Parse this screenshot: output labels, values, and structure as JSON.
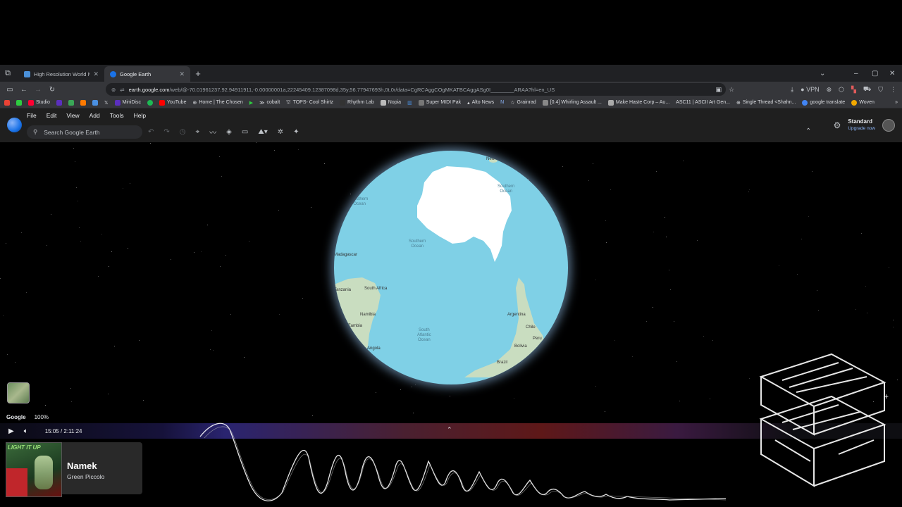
{
  "tabs": [
    {
      "title": "High Resolution World Map - G",
      "active": false,
      "favicon_color": "#4a90d9"
    },
    {
      "title": "Google Earth",
      "active": true,
      "favicon_color": "#1a73e8"
    }
  ],
  "address": {
    "host": "earth.google.com",
    "path": "/web/@-70.01961237,92.94911911,-0.00000001a,22245409.12387098d,35y,56.77947693h,0t,0r/data=CgRCAggCOgMKATBCAggASg0I________ARAA?hl=en_US"
  },
  "toolbar_right": {
    "vpn_label": "VPN"
  },
  "bookmarks": [
    {
      "label": "Studio",
      "color": "#ff0033"
    },
    {
      "label": "MiniDisc",
      "color": "#5b2fbf"
    },
    {
      "label": "YouTube",
      "color": "#ff0000"
    },
    {
      "label": "Home | The Chosen",
      "color": "#cccccc"
    },
    {
      "label": "cobalt",
      "color": "#ffffff"
    },
    {
      "label": "TOPS- Cool Shirtz",
      "color": "#999999"
    },
    {
      "label": "Rhythm Lab",
      "color": "#333333"
    },
    {
      "label": "Nopia",
      "color": "#bbbbbb"
    },
    {
      "label": "Super MIDI Pak",
      "color": "#777777"
    },
    {
      "label": "Alto News",
      "color": "#dddddd"
    },
    {
      "label": "Grainrad",
      "color": "#eeeeee"
    },
    {
      "label": "[0.4] Whirling Assault ...",
      "color": "#888888"
    },
    {
      "label": "Make Haste Corp – Au...",
      "color": "#aaaaaa"
    },
    {
      "label": "ASC11 | ASCII Art Gen...",
      "color": "#444444"
    },
    {
      "label": "Single Thread <Shahn...",
      "color": "#cccccc"
    },
    {
      "label": "google translate",
      "color": "#4285f4"
    },
    {
      "label": "Woven",
      "color": "#f2a900"
    }
  ],
  "menu": [
    "File",
    "Edit",
    "View",
    "Add",
    "Tools",
    "Help"
  ],
  "search": {
    "placeholder": "Search Google Earth"
  },
  "account": {
    "plan": "Standard",
    "upgrade": "Upgrade now"
  },
  "map_labels": {
    "new_zealand": "New\nZealand",
    "southern_ocean_top": "Southern\nOcean",
    "southern_ocean_left": "Southern\nOcean",
    "southern_ocean_mid": "Southern\nOcean",
    "madagascar": "Madagascar",
    "south_africa": "South Africa",
    "tanzania": "Tanzania",
    "namibia": "Namibia",
    "angola": "Angola",
    "zambia": "Zambia",
    "south_atlantic": "South\nAtlantic\nOcean",
    "argentina": "Argentina",
    "chile": "Chile",
    "bolivia": "Bolivia",
    "peru": "Peru",
    "brazil": "Brazil"
  },
  "status": {
    "brand": "Google",
    "zoom": "100%"
  },
  "player": {
    "time": "15:05 / 2:11:24",
    "title": "Namek",
    "artist": "Green Piccolo",
    "album_caption": "LIGHT IT UP"
  }
}
